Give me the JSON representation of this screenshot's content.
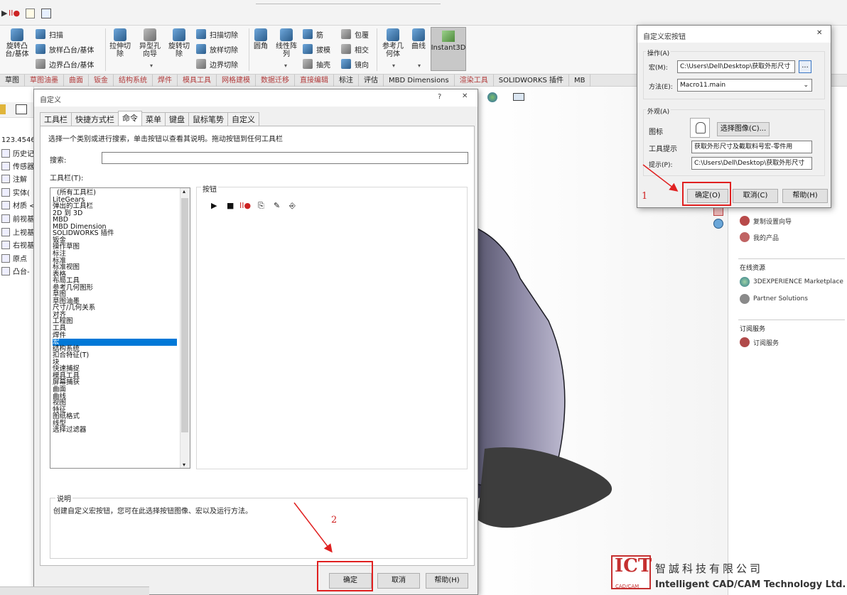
{
  "quick_access": {
    "items": [
      "▶",
      "II●"
    ]
  },
  "ribbon": {
    "buttons": [
      {
        "label": "旋转凸\n台/基体"
      },
      {
        "label": "拉伸切\n除"
      },
      {
        "label": "异型孔\n向导"
      },
      {
        "label": "旋转切\n除"
      },
      {
        "label": "圆角"
      },
      {
        "label": "线性阵\n列"
      },
      {
        "label": "参考几\n何体"
      },
      {
        "label": "曲线"
      },
      {
        "label": "Instant3D"
      }
    ],
    "small": {
      "sweep": "扫描",
      "loft": "放样凸台/基体",
      "boundary": "边界凸台/基体",
      "sweep_cut": "扫描切除",
      "loft_cut": "放样切除",
      "boundary_cut": "边界切除",
      "rib": "筋",
      "draft": "拔模",
      "shell": "抽壳",
      "wrap": "包覆",
      "intersect": "相交",
      "mirror": "镜向"
    },
    "tabs": [
      "草图",
      "草图油墨",
      "曲面",
      "钣金",
      "结构系统",
      "焊件",
      "模具工具",
      "网格建模",
      "数据迁移",
      "直接编辑",
      "标注",
      "评估",
      "MBD Dimensions",
      "渲染工具",
      "SOLIDWORKS 插件",
      "MB"
    ]
  },
  "tree": {
    "top_value": "123.4546.",
    "items": [
      "历史记",
      "传感器",
      "注解",
      "实体(",
      "材质 <",
      "前视基",
      "上视基",
      "右视基",
      "原点",
      "凸台-"
    ]
  },
  "right_pane": {
    "items_top": [
      "复制设置向导",
      "我的产品"
    ],
    "online_title": "在线资源",
    "online_items": [
      "3DEXPERIENCE Marketplace",
      "Partner Solutions"
    ],
    "sub_title": "订阅服务",
    "sub_items": [
      "订阅服务"
    ]
  },
  "customize": {
    "title": "自定义",
    "help": "?",
    "close": "✕",
    "tabs": [
      "工具栏",
      "快捷方式栏",
      "命令",
      "菜单",
      "键盘",
      "鼠标笔势",
      "自定义"
    ],
    "instruction": "选择一个类别或进行搜索，单击按钮以查看其说明。拖动按钮到任何工具栏",
    "search_label": "搜索:",
    "toolbars_label": "工具栏(T):",
    "toolbar_items": [
      "(所有工具栏)",
      "LiteGears",
      "弹出的工具栏",
      "2D 到 3D",
      "MBD",
      "MBD Dimension",
      "SOLIDWORKS 插件",
      "钣金",
      "操作草图",
      "标注",
      "标准",
      "标准视图",
      "表格",
      "布局工具",
      "参考几何图形",
      "草图",
      "草图油墨",
      "尺寸/几何关系",
      "对齐",
      "工程图",
      "工具",
      "焊件",
      "宏",
      "结构系统",
      "扣合特征(T)",
      "块",
      "快速捕捉",
      "模具工具",
      "屏幕捕获",
      "曲面",
      "曲线",
      "视图",
      "特征",
      "图纸格式",
      "线型",
      "选择过滤器"
    ],
    "selected_index": 22,
    "buttons_label": "按钮",
    "macro_buttons": [
      "▶",
      "■",
      "II●",
      "⎘",
      "✎",
      "⎆"
    ],
    "desc_label": "说明",
    "desc_text": "创建自定义宏按钮，您可在此选择按钮图像、宏以及运行方法。",
    "ok": "确定",
    "cancel": "取消",
    "help_btn": "帮助(H)"
  },
  "macro_dialog": {
    "title": "自定义宏按钮",
    "close": "✕",
    "operation_label": "操作(A)",
    "macro_label": "宏(M):",
    "macro_path": "C:\\Users\\Dell\\Desktop\\获取外形尺寸",
    "browse": "...",
    "method_label": "方法(E):",
    "method_value": "Macro11.main",
    "appearance_label": "外观(A)",
    "icon_label": "图标",
    "choose_image": "选择图像(C)...",
    "tooltip_label": "工具提示",
    "tooltip_value": "获取外形尺寸及截取料号宏-零件用",
    "prompt_label": "提示(P):",
    "prompt_value": "C:\\Users\\Dell\\Desktop\\获取外形尺寸",
    "ok": "确定(O)",
    "cancel": "取消(C)",
    "help": "帮助(H)"
  },
  "annotations": {
    "n1": "1",
    "n2": "2"
  },
  "watermark": {
    "logo": "ICT",
    "logo_sub": "CAD/CAM",
    "cn": "智誠科技有限公司",
    "en": "Intelligent CAD/CAM Technology Ltd."
  },
  "colors": {
    "accent": "#0078d7",
    "annotation": "#e02020",
    "watermark": "#c53030"
  }
}
